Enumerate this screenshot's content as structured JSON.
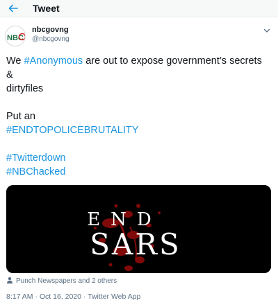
{
  "header": {
    "title": "Tweet",
    "back_icon": "back-arrow-icon"
  },
  "author": {
    "display_name": "nbcgovng",
    "handle": "@nbcgovng",
    "avatar_label": "NBC"
  },
  "tweet": {
    "line1_prefix": "We ",
    "line1_hashtag": "#Anonymous",
    "line1_suffix": " are out to expose government’s secrets",
    "line2": "&",
    "line3": "dirtyfiles",
    "line4": "Put an",
    "hashtag_endpolice": "#ENDTOPOLICEBRUTALITY",
    "hashtag_twitterdown": "#Twitterdown",
    "hashtag_nbchacked": "#NBChacked"
  },
  "media": {
    "line1": "END",
    "line2": "SARS"
  },
  "tagged": {
    "text": "Punch Newspapers and 2 others"
  },
  "meta": {
    "timestamp": "8:17 AM · Oct 16, 2020 · Twitter Web App"
  },
  "colors": {
    "link": "#1b95e0",
    "muted": "#5b7083",
    "header_bg": "#f7f9f9",
    "blood": "#8b0a0a"
  }
}
